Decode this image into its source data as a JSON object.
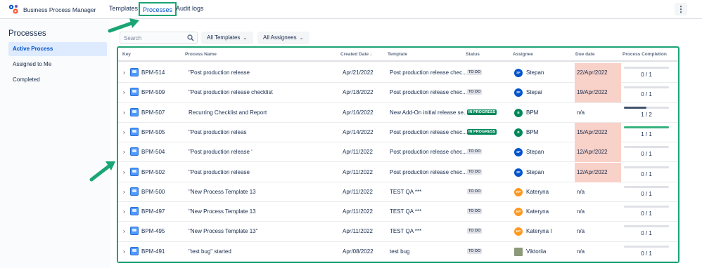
{
  "app": {
    "title": "Business Process Manager"
  },
  "nav": {
    "templates": "Templates",
    "processes": "Processes",
    "audit": "Audit logs",
    "more": "⋮"
  },
  "sidebar": {
    "title": "Processes",
    "items": [
      {
        "label": "Active Process",
        "active": true
      },
      {
        "label": "Assigned to Me",
        "active": false
      },
      {
        "label": "Completed",
        "active": false
      }
    ]
  },
  "filters": {
    "search_placeholder": "Search",
    "templates": "All Templates",
    "assignees": "All Assignees"
  },
  "table": {
    "headers": {
      "key": "Key",
      "name": "Process Name",
      "created": "Created Date ↓",
      "template": "Template",
      "status": "Status",
      "assignee": "Assignee",
      "due": "Due date",
      "completion": "Process Completion"
    },
    "rows": [
      {
        "key": "BPM-514",
        "name": "\"Post production release",
        "created": "Apr/21/2022",
        "template": "Post production release chec...",
        "status": "TO DO",
        "avatar": "SF",
        "assignee": "Stepan",
        "due": "22/Apr/2022",
        "overdue": true,
        "progress": "0 / 1",
        "fraction": 0
      },
      {
        "key": "BPM-509",
        "name": "\"Post production release checklist",
        "created": "Apr/18/2022",
        "template": "Post production release chec...",
        "status": "TO DO",
        "avatar": "SF",
        "assignee": "Stepai",
        "due": "19/Apr/2022",
        "overdue": true,
        "progress": "0 / 1",
        "fraction": 0
      },
      {
        "key": "BPM-507",
        "name": "Recurring Checklist and Report",
        "created": "Apr/16/2022",
        "template": "New Add-On initial release se...",
        "status": "IN PROGRESS",
        "avatar": "B",
        "assignee": "BPM",
        "due": "n/a",
        "overdue": false,
        "progress": "1 / 2",
        "fraction": 0.5
      },
      {
        "key": "BPM-505",
        "name": "\"Post production releas",
        "created": "Apr/14/2022",
        "template": "Post production release chec...",
        "status": "IN PROGRESS",
        "avatar": "B",
        "assignee": "BPM",
        "due": "15/Apr/2022",
        "overdue": true,
        "progress": "1 / 1",
        "fraction": 1
      },
      {
        "key": "BPM-504",
        "name": "\"Post production release ‘",
        "created": "Apr/11/2022",
        "template": "Post production release chec...",
        "status": "TO DO",
        "avatar": "SF",
        "assignee": "Stepan",
        "due": "12/Apr/2022",
        "overdue": true,
        "progress": "0 / 1",
        "fraction": 0
      },
      {
        "key": "BPM-502",
        "name": "\"Post production release",
        "created": "Apr/11/2022",
        "template": "Post production release chec...",
        "status": "TO DO",
        "avatar": "SF",
        "assignee": "Stepan",
        "due": "12/Apr/2022",
        "overdue": true,
        "progress": "0 / 1",
        "fraction": 0
      },
      {
        "key": "BPM-500",
        "name": "\"New Process Template 13",
        "created": "Apr/11/2022",
        "template": "TEST QA ***",
        "status": "TO DO",
        "avatar": "KP",
        "assignee": "Kateryna",
        "due": "n/a",
        "overdue": false,
        "progress": "0 / 1",
        "fraction": 0
      },
      {
        "key": "BPM-497",
        "name": "\"New Process Template 13",
        "created": "Apr/11/2022",
        "template": "TEST QA ***",
        "status": "TO DO",
        "avatar": "KP",
        "assignee": "Kateryna",
        "due": "n/a",
        "overdue": false,
        "progress": "0 / 1",
        "fraction": 0
      },
      {
        "key": "BPM-495",
        "name": "\"New Process Template 13\"",
        "created": "Apr/11/2022",
        "template": "TEST QA ***",
        "status": "TO DO",
        "avatar": "KP",
        "assignee": "Kateryna I",
        "due": "n/a",
        "overdue": false,
        "progress": "0 / 1",
        "fraction": 0
      },
      {
        "key": "BPM-491",
        "name": "\"test bug\" started",
        "created": "Apr/08/2022",
        "template": "test bug",
        "status": "TO DO",
        "avatar": "",
        "assignee": "Viktoriia",
        "due": "n/a",
        "overdue": false,
        "progress": "0 / 1",
        "fraction": 0
      }
    ]
  },
  "colors": {
    "highlight": "#1aa574",
    "accent": "#0052cc",
    "overdue": "#f8d1c8",
    "progress_full": "#36b37e",
    "progress_partial": "#42526e"
  }
}
